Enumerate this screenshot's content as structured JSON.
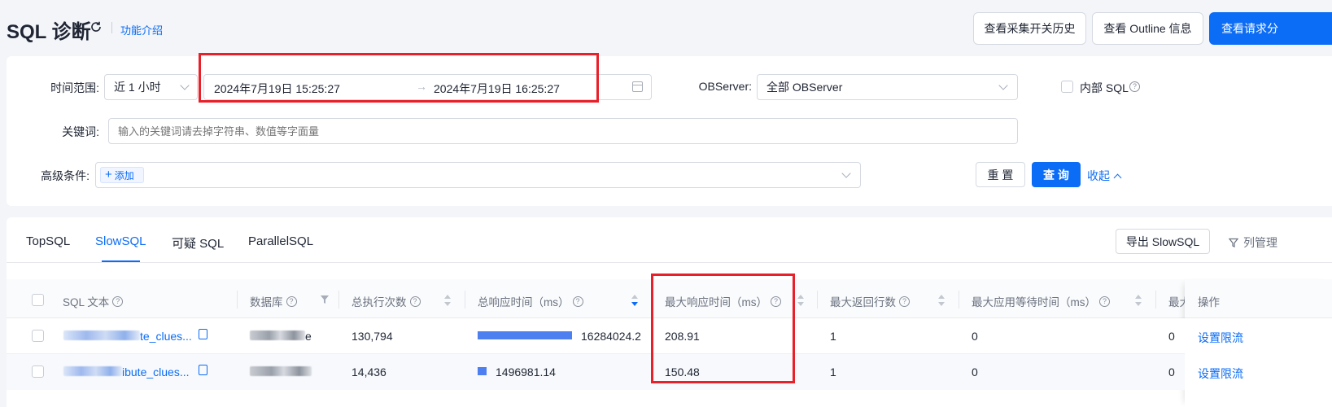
{
  "header": {
    "title": "SQL 诊断",
    "feature_intro": "功能介绍",
    "buttons": {
      "collect_history": "查看采集开关历史",
      "outline": "查看 Outline 信息",
      "request_analysis": "查看请求分"
    }
  },
  "filters": {
    "time_range_label": "时间范围:",
    "time_range_value": "近 1 小时",
    "start_time": "2024年7月19日 15:25:27",
    "end_time": "2024年7月19日 16:25:27",
    "observer_label": "OBServer:",
    "observer_value": "全部 OBServer",
    "internal_sql_label": "内部 SQL",
    "keyword_label": "关键词:",
    "keyword_placeholder": "输入的关键词请去掉字符串、数值等字面量",
    "advanced_label": "高级条件:",
    "add_label": "添加",
    "reset": "重 置",
    "query": "查 询",
    "collapse": "收起"
  },
  "tabs": [
    "TopSQL",
    "SlowSQL",
    "可疑 SQL",
    "ParallelSQL"
  ],
  "active_tab": "SlowSQL",
  "toolbar": {
    "export": "导出 SlowSQL",
    "columns": "列管理"
  },
  "table": {
    "headers": {
      "sql_text": "SQL 文本",
      "database": "数据库",
      "total_exec": "总执行次数",
      "total_resp": "总响应时间（ms）",
      "max_resp": "最大响应时间（ms）",
      "max_rows": "最大返回行数",
      "max_wait": "最大应用等待时间（ms）",
      "more": "最大",
      "ops": "操作"
    },
    "rows": [
      {
        "sql_text": "te_clues...",
        "database": "e",
        "total_exec": "130,794",
        "total_resp": "16284024.2",
        "total_resp_share": 0.91,
        "max_resp": "208.91",
        "max_rows": "1",
        "max_wait": "0",
        "more": "0",
        "op": "设置限流"
      },
      {
        "sql_text": "ibute_clues...",
        "database": "",
        "total_exec": "14,436",
        "total_resp": "1496981.14",
        "total_resp_share": 0.083,
        "max_resp": "150.48",
        "max_rows": "1",
        "max_wait": "0",
        "more": "0",
        "op": "设置限流"
      }
    ]
  },
  "colors": {
    "accent": "#0b6cf5",
    "highlight": "#e8202a"
  }
}
